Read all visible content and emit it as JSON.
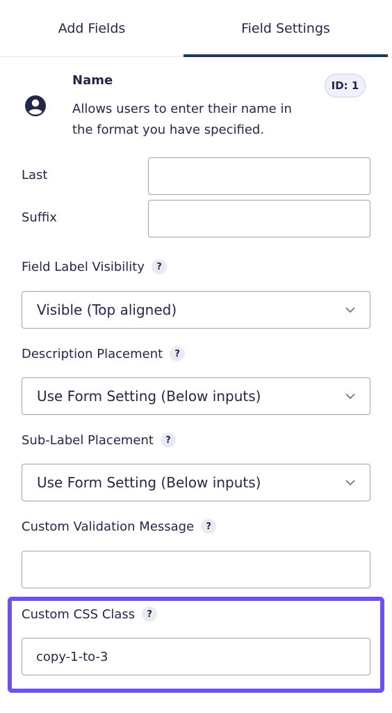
{
  "tabs": {
    "add_fields": "Add Fields",
    "field_settings": "Field Settings"
  },
  "field": {
    "title": "Name",
    "description": "Allows users to enter their name in the format you have specified.",
    "id_badge": "ID: 1",
    "icon": "user-circle-icon"
  },
  "subfields": [
    {
      "label": "Last",
      "value": ""
    },
    {
      "label": "Suffix",
      "value": ""
    }
  ],
  "label_visibility": {
    "label": "Field Label Visibility",
    "help": "?",
    "selected": "Visible (Top aligned)"
  },
  "description_placement": {
    "label": "Description Placement",
    "help": "?",
    "selected": "Use Form Setting (Below inputs)"
  },
  "sublabel_placement": {
    "label": "Sub-Label Placement",
    "help": "?",
    "selected": "Use Form Setting (Below inputs)"
  },
  "custom_validation": {
    "label": "Custom Validation Message",
    "help": "?",
    "value": ""
  },
  "custom_css": {
    "label": "Custom CSS Class",
    "help": "?",
    "value": "copy-1-to-3"
  },
  "colors": {
    "tab_underline": "#1d3a5f",
    "highlight": "#7050f2",
    "text": "#242748"
  }
}
